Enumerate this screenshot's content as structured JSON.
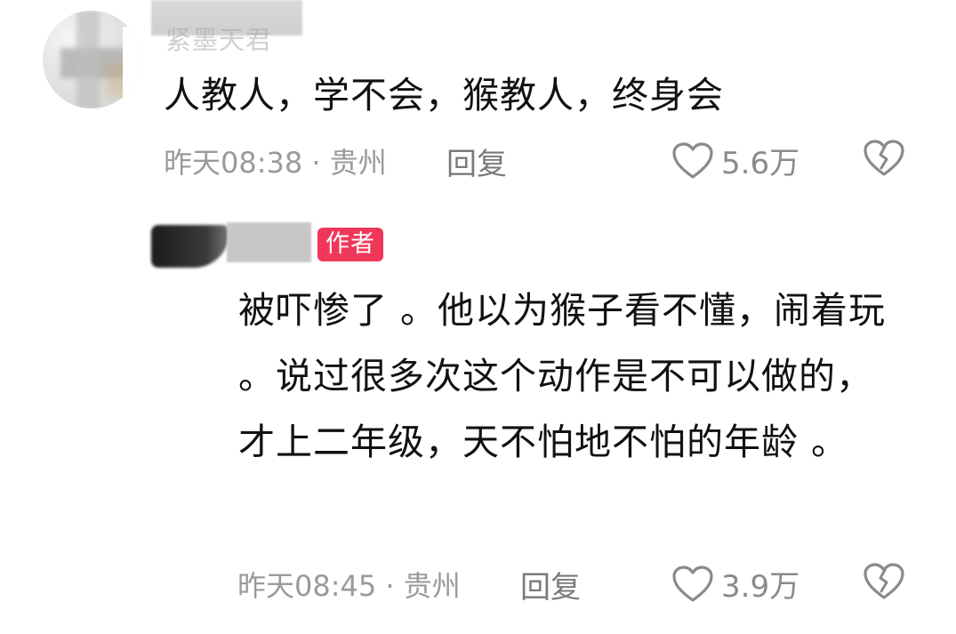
{
  "comments": [
    {
      "username": "紧墨天君",
      "text": "人教人，学不会，猴教人，终身会",
      "time_location": "昨天08:38 · 贵州",
      "reply_label": "回复",
      "likes": "5.6万",
      "like_icon": "heart-outline-icon",
      "dislike_icon": "broken-heart-icon"
    },
    {
      "badge": "作者",
      "text": "被吓惨了 。他以为猴子看不懂，闹着玩 。说过很多次这个动作是不可以做的，才上二年级，天不怕地不怕的年龄 。",
      "time_location": "昨天08:45 · 贵州",
      "reply_label": "回复",
      "likes": "3.9万",
      "like_icon": "heart-outline-icon",
      "dislike_icon": "broken-heart-icon"
    }
  ],
  "colors": {
    "badge_bg": "#f0375a",
    "meta_text": "#9a9a9a",
    "body_text": "#111111"
  }
}
